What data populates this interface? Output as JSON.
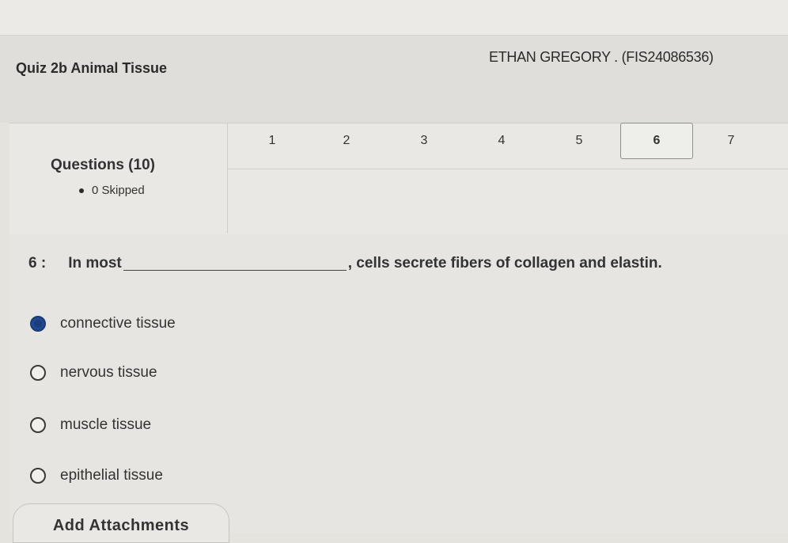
{
  "header": {
    "quiz_title": "Quiz 2b Animal Tissue",
    "student": "ETHAN GREGORY . (FIS24086536)"
  },
  "navigator": {
    "title": "Questions (10)",
    "skipped": "0 Skipped",
    "tabs": [
      "1",
      "2",
      "3",
      "4",
      "5",
      "6",
      "7"
    ],
    "active_tab": "6"
  },
  "question": {
    "number": "6 :",
    "text_before": "In most",
    "text_after": ", cells secrete fibers of collagen and elastin."
  },
  "options": [
    {
      "label": "connective tissue",
      "selected": true
    },
    {
      "label": "nervous tissue",
      "selected": false
    },
    {
      "label": "muscle tissue",
      "selected": false
    },
    {
      "label": "epithelial tissue",
      "selected": false
    }
  ],
  "attach_label": "Add Attachments",
  "colors": {
    "selected_radio": "#1f4a92",
    "background": "#e4e3de"
  }
}
